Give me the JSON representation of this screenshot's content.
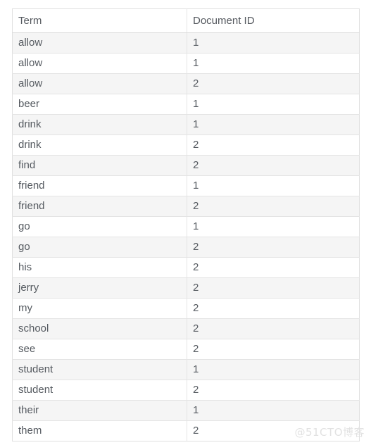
{
  "table": {
    "caption": "",
    "columns": [
      {
        "key": "term",
        "label": "Term"
      },
      {
        "key": "document_id",
        "label": "Document ID"
      }
    ],
    "rows": [
      {
        "term": "allow",
        "document_id": "1"
      },
      {
        "term": "allow",
        "document_id": "1"
      },
      {
        "term": "allow",
        "document_id": "2"
      },
      {
        "term": "beer",
        "document_id": "1"
      },
      {
        "term": "drink",
        "document_id": "1"
      },
      {
        "term": "drink",
        "document_id": "2"
      },
      {
        "term": "find",
        "document_id": "2"
      },
      {
        "term": "friend",
        "document_id": "1"
      },
      {
        "term": "friend",
        "document_id": "2"
      },
      {
        "term": "go",
        "document_id": "1"
      },
      {
        "term": "go",
        "document_id": "2"
      },
      {
        "term": "his",
        "document_id": "2"
      },
      {
        "term": "jerry",
        "document_id": "2"
      },
      {
        "term": "my",
        "document_id": "2"
      },
      {
        "term": "school",
        "document_id": "2"
      },
      {
        "term": "see",
        "document_id": "2"
      },
      {
        "term": "student",
        "document_id": "1"
      },
      {
        "term": "student",
        "document_id": "2"
      },
      {
        "term": "their",
        "document_id": "1"
      },
      {
        "term": "them",
        "document_id": "2"
      }
    ]
  },
  "watermark": {
    "text": "@51CTO博客"
  },
  "colors": {
    "text": "#555a60",
    "row_stripe": "#f5f5f5",
    "row_base": "#ffffff",
    "border": "#e4e4e4",
    "watermark": "#e2e2e2"
  }
}
